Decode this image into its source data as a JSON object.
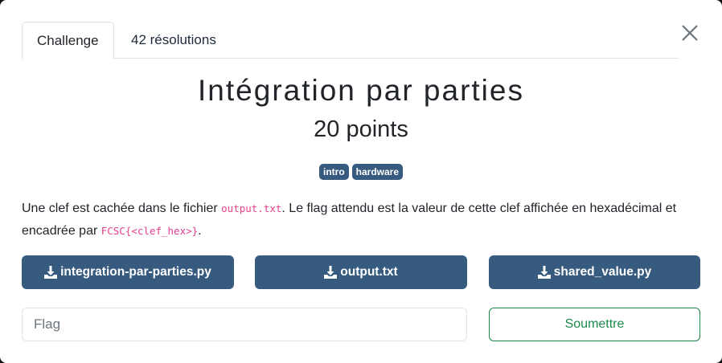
{
  "tabs": [
    {
      "label": "Challenge"
    },
    {
      "label": "42 résolutions"
    }
  ],
  "challenge": {
    "title": "Intégration par parties",
    "points": "20 points",
    "tags": [
      "intro",
      "hardware"
    ],
    "description": {
      "part1": "Une clef est cachée dans le fichier ",
      "code1": "output.txt",
      "part2": ". Le flag attendu est la valeur de cette clef affichée en hexadécimal et encadrée par ",
      "code2": "FCSC{<clef_hex>}",
      "part3": "."
    },
    "files": [
      "integration-par-parties.py",
      "output.txt",
      "shared_value.py"
    ]
  },
  "form": {
    "flag_placeholder": "Flag",
    "submit_label": "Soumettre"
  },
  "colors": {
    "primary": "#375a7f",
    "success": "#1b8a4a",
    "code": "#e83e8c"
  }
}
